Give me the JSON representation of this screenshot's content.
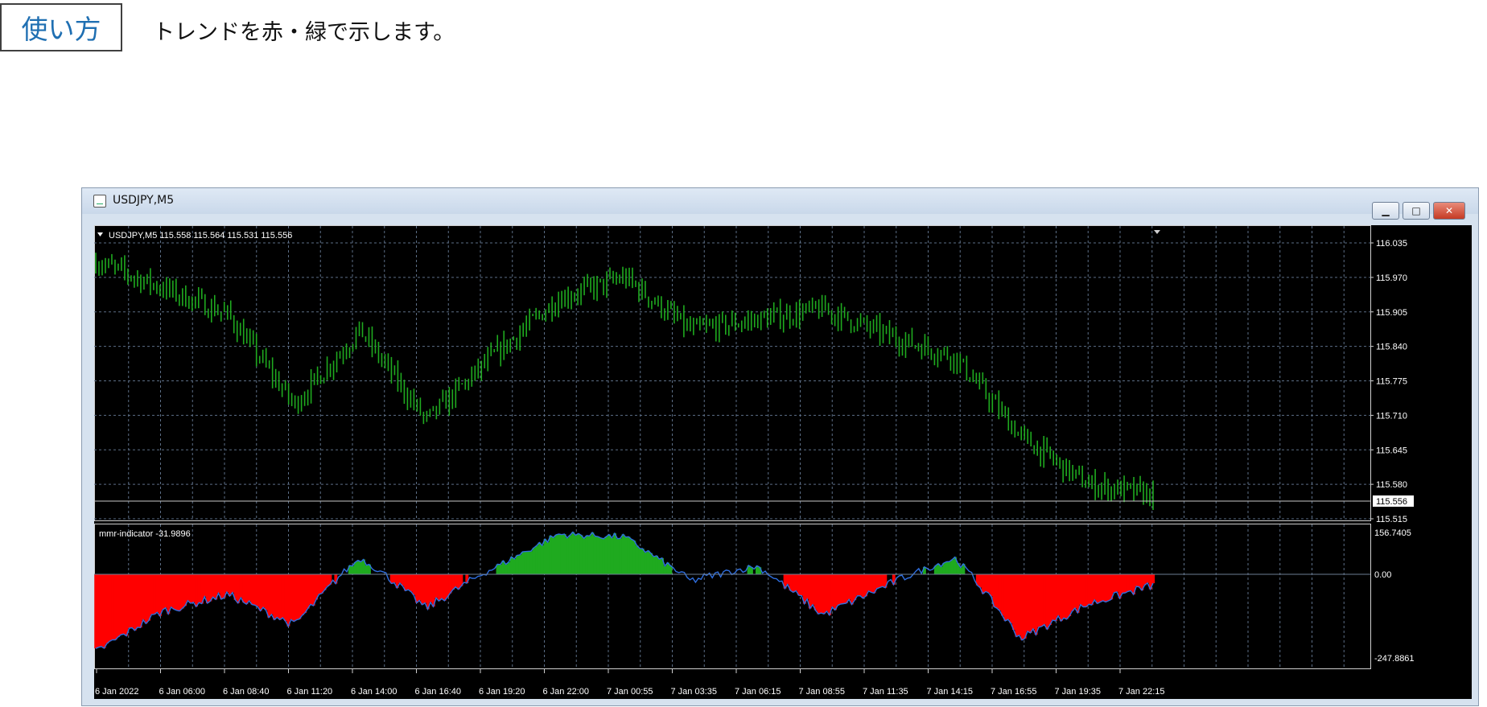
{
  "header": {
    "box_label": "使い方",
    "description": "トレンドを赤・緑で示します。"
  },
  "window": {
    "title": "USDJPY,M5",
    "buttons": {
      "minimize": "▁",
      "maximize": "□",
      "close": "✕"
    }
  },
  "main_chart": {
    "info": "USDJPY,M5  115.558 115.564 115.531 115.556",
    "price_ticks": [
      "116.035",
      "115.970",
      "115.905",
      "115.840",
      "115.775",
      "115.710",
      "115.645",
      "115.580",
      "115.515"
    ],
    "current_price": "115.556"
  },
  "sub_chart": {
    "info": "mmr-indicator -31.9896",
    "ticks": [
      "156.7405",
      "0.00",
      "-247.8861"
    ]
  },
  "time_axis": [
    "6 Jan 2022",
    "6 Jan 06:00",
    "6 Jan 08:40",
    "6 Jan 11:20",
    "6 Jan 14:00",
    "6 Jan 16:40",
    "6 Jan 19:20",
    "6 Jan 22:00",
    "7 Jan 00:55",
    "7 Jan 03:35",
    "7 Jan 06:15",
    "7 Jan 08:55",
    "7 Jan 11:35",
    "7 Jan 14:15",
    "7 Jan 16:55",
    "7 Jan 19:35",
    "7 Jan 22:15"
  ],
  "colors": {
    "bull": "#1faa1f",
    "bear": "#ff0000",
    "grid": "#5c6e86",
    "line": "#2f6fe0",
    "text": "#ffffff"
  },
  "chart_data": [
    {
      "type": "line",
      "ylim": [
        115.515,
        116.035
      ],
      "x": [
        "6 Jan 2022",
        "6 Jan 06:00",
        "6 Jan 08:40",
        "6 Jan 11:20",
        "6 Jan 14:00",
        "6 Jan 16:40",
        "6 Jan 19:20",
        "6 Jan 22:00",
        "7 Jan 00:55",
        "7 Jan 03:35",
        "7 Jan 06:15",
        "7 Jan 08:55",
        "7 Jan 11:35",
        "7 Jan 14:15",
        "7 Jan 16:55",
        "7 Jan 19:35",
        "7 Jan 22:15"
      ],
      "values": [
        116.0,
        115.95,
        115.9,
        115.73,
        115.87,
        115.7,
        115.82,
        115.93,
        115.97,
        115.87,
        115.89,
        115.91,
        115.86,
        115.82,
        115.67,
        115.58,
        115.56
      ]
    },
    {
      "type": "bar",
      "ylim": [
        -247.8861,
        156.7405
      ],
      "x": [
        "6 Jan 2022",
        "6 Jan 06:00",
        "6 Jan 08:40",
        "6 Jan 11:20",
        "6 Jan 14:00",
        "6 Jan 16:40",
        "6 Jan 19:20",
        "6 Jan 22:00",
        "7 Jan 00:55",
        "7 Jan 03:35",
        "7 Jan 06:15",
        "7 Jan 08:55",
        "7 Jan 11:35",
        "7 Jan 14:15",
        "7 Jan 16:55",
        "7 Jan 19:35",
        "7 Jan 22:15"
      ],
      "values": [
        -230,
        -110,
        -60,
        -150,
        60,
        -100,
        20,
        150,
        140,
        -20,
        30,
        -120,
        -30,
        60,
        -190,
        -90,
        -32
      ]
    }
  ]
}
